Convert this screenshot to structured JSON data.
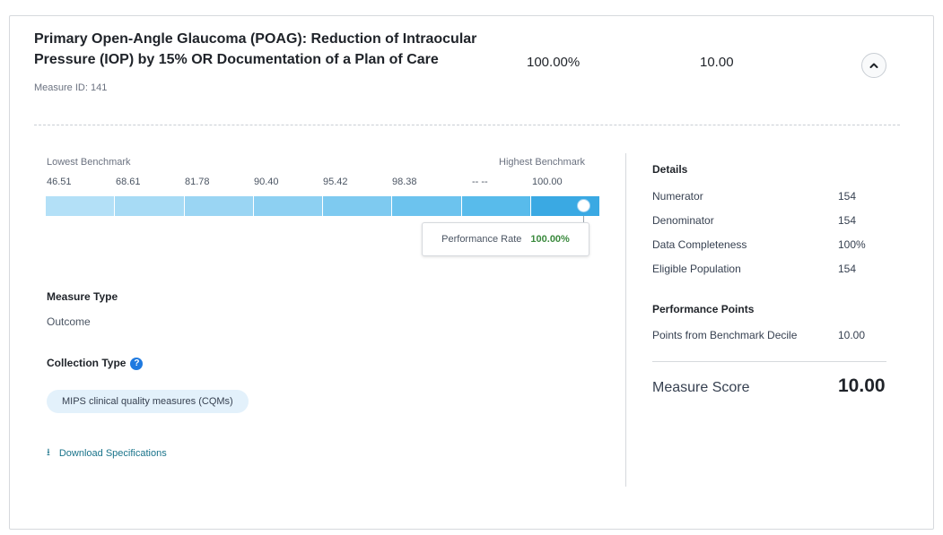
{
  "measure": {
    "title": "Primary Open-Angle Glaucoma (POAG): Reduction of Intraocular Pressure (IOP) by 15% OR Documentation of a Plan of Care",
    "measure_id": "Measure ID: 141",
    "performance_rate": "100.00%",
    "score": "10.00"
  },
  "benchmark": {
    "lowest_label": "Lowest Benchmark",
    "highest_label": "Highest Benchmark",
    "ticks": [
      "46.51",
      "68.61",
      "81.78",
      "90.40",
      "95.42",
      "98.38",
      "-- --",
      "100.00"
    ],
    "segment_colors": [
      "#b3e0f7",
      "#a7dbf5",
      "#9ad5f3",
      "#8dd0f2",
      "#7ecaf0",
      "#6cc3ee",
      "#58bbeb",
      "#3aa9e3"
    ],
    "marker_fraction": 1.0,
    "tooltip_label": "Performance Rate",
    "tooltip_value": "100.00%"
  },
  "measure_type": {
    "heading": "Measure Type",
    "value": "Outcome"
  },
  "collection_type": {
    "heading": "Collection Type",
    "help_icon": "question-circle-icon",
    "pill": "MIPS clinical quality measures (CQMs)"
  },
  "download": {
    "icon": "download-icon",
    "label": "Download Specifications"
  },
  "details": {
    "heading": "Details",
    "rows": [
      {
        "label": "Numerator",
        "value": "154"
      },
      {
        "label": "Denominator",
        "value": "154"
      },
      {
        "label": "Data Completeness",
        "value": "100%"
      },
      {
        "label": "Eligible Population",
        "value": "154"
      }
    ]
  },
  "performance_points": {
    "heading": "Performance Points",
    "rows": [
      {
        "label": "Points from Benchmark Decile",
        "value": "10.00"
      }
    ]
  },
  "measure_score": {
    "label": "Measure Score",
    "value": "10.00"
  }
}
